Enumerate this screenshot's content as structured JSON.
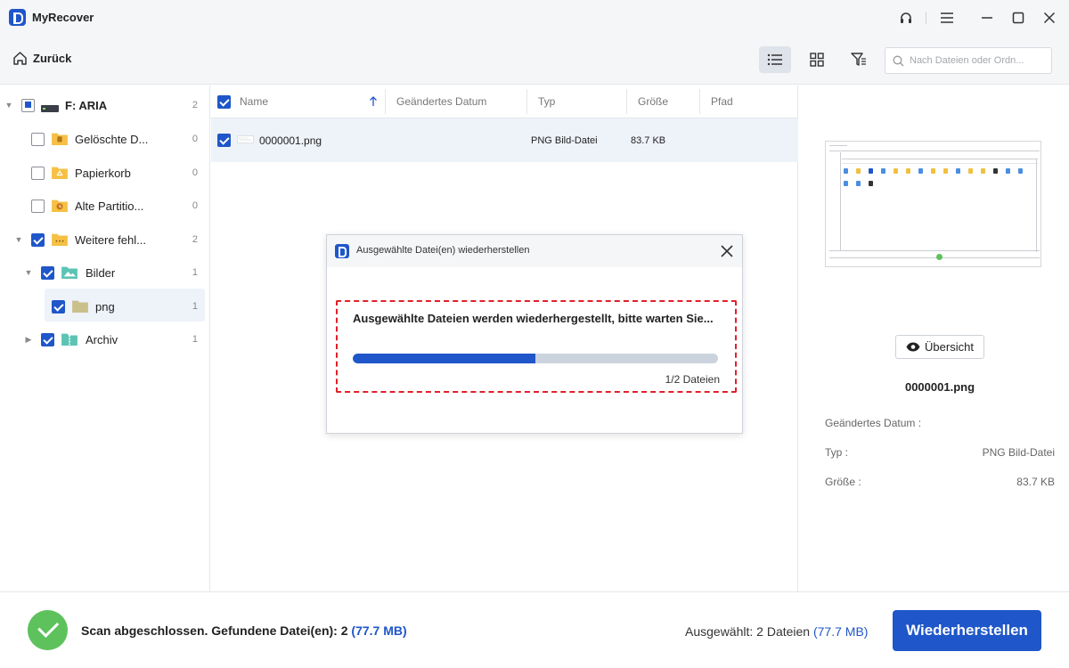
{
  "app": {
    "title": "MyRecover"
  },
  "toolbar": {
    "back_label": "Zurück",
    "search_placeholder": "Nach Dateien oder Ordn..."
  },
  "tree": {
    "root": {
      "label": "F: ARIA",
      "count": "2"
    },
    "items": [
      {
        "label": "Gelöschte D...",
        "count": "0"
      },
      {
        "label": "Papierkorb",
        "count": "0"
      },
      {
        "label": "Alte Partitio...",
        "count": "0"
      },
      {
        "label": "Weitere fehl...",
        "count": "2"
      },
      {
        "label": "Bilder",
        "count": "1"
      },
      {
        "label": "png",
        "count": "1"
      },
      {
        "label": "Archiv",
        "count": "1"
      }
    ]
  },
  "filelist": {
    "columns": [
      "Name",
      "Geändertes Datum",
      "Typ",
      "Größe",
      "Pfad"
    ],
    "rows": [
      {
        "name": "0000001.png",
        "date": "",
        "type": "PNG Bild-Datei",
        "size": "83.7 KB",
        "path": ""
      }
    ]
  },
  "preview": {
    "overview_label": "Übersicht",
    "file_name": "0000001.png",
    "fields": [
      {
        "label": "Geändertes Datum :",
        "value": ""
      },
      {
        "label": "Typ :",
        "value": "PNG Bild-Datei"
      },
      {
        "label": "Größe :",
        "value": "83.7 KB"
      }
    ]
  },
  "bottom": {
    "scan_text": "Scan abgeschlossen. Gefundene Datei(en): 2",
    "scan_size": "(77.7 MB)",
    "selected_text": "Ausgewählt: 2 Dateien",
    "selected_size": "(77.7 MB)",
    "restore_label": "Wiederherstellen"
  },
  "dialog": {
    "title": "Ausgewählte Datei(en) wiederherstellen",
    "message": "Ausgewählte Dateien werden wiederhergestellt, bitte warten Sie...",
    "progress": 0.5,
    "progress_count": "1/2 Dateien"
  },
  "colors": {
    "accent": "#1f56c9",
    "success": "#5dc25c",
    "highlight_border": "#e0202a"
  }
}
